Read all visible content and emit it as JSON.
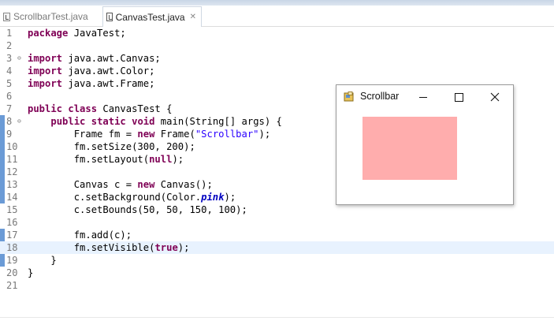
{
  "tabs": [
    {
      "label": "ScrollbarTest.java",
      "active": false
    },
    {
      "label": "CanvasTest.java",
      "active": true,
      "close": "✕"
    }
  ],
  "editor": {
    "lines": [
      {
        "num": "1",
        "tokens": [
          {
            "t": "package",
            "c": "kw"
          },
          {
            "t": " JavaTest;"
          }
        ]
      },
      {
        "num": "2",
        "tokens": []
      },
      {
        "num": "3",
        "fold": "⊖",
        "tokens": [
          {
            "t": "import",
            "c": "kw"
          },
          {
            "t": " java.awt.Canvas;"
          }
        ]
      },
      {
        "num": "4",
        "tokens": [
          {
            "t": "import",
            "c": "kw"
          },
          {
            "t": " java.awt.Color;"
          }
        ]
      },
      {
        "num": "5",
        "tokens": [
          {
            "t": "import",
            "c": "kw"
          },
          {
            "t": " java.awt.Frame;"
          }
        ]
      },
      {
        "num": "6",
        "tokens": []
      },
      {
        "num": "7",
        "tokens": [
          {
            "t": "public",
            "c": "kw"
          },
          {
            "t": " "
          },
          {
            "t": "class",
            "c": "kw"
          },
          {
            "t": " CanvasTest {"
          }
        ]
      },
      {
        "num": "8",
        "fold": "⊖",
        "tokens": [
          {
            "t": "    "
          },
          {
            "t": "public",
            "c": "kw"
          },
          {
            "t": " "
          },
          {
            "t": "static",
            "c": "kw"
          },
          {
            "t": " "
          },
          {
            "t": "void",
            "c": "kw"
          },
          {
            "t": " main(String[] args) {"
          }
        ]
      },
      {
        "num": "9",
        "tokens": [
          {
            "t": "        Frame fm = "
          },
          {
            "t": "new",
            "c": "kw"
          },
          {
            "t": " Frame("
          },
          {
            "t": "\"Scrollbar\"",
            "c": "str"
          },
          {
            "t": ");"
          }
        ]
      },
      {
        "num": "10",
        "tokens": [
          {
            "t": "        fm.setSize(300, 200);"
          }
        ]
      },
      {
        "num": "11",
        "tokens": [
          {
            "t": "        fm.setLayout("
          },
          {
            "t": "null",
            "c": "kw"
          },
          {
            "t": ");"
          }
        ]
      },
      {
        "num": "12",
        "tokens": []
      },
      {
        "num": "13",
        "tokens": [
          {
            "t": "        Canvas c = "
          },
          {
            "t": "new",
            "c": "kw"
          },
          {
            "t": " Canvas();"
          }
        ]
      },
      {
        "num": "14",
        "tokens": [
          {
            "t": "        c.setBackground(Color."
          },
          {
            "t": "pink",
            "c": "field"
          },
          {
            "t": ");"
          }
        ]
      },
      {
        "num": "15",
        "tokens": [
          {
            "t": "        c.setBounds(50, 50, 150, 100);"
          }
        ]
      },
      {
        "num": "16",
        "tokens": []
      },
      {
        "num": "17",
        "tokens": [
          {
            "t": "        fm.add(c);"
          }
        ]
      },
      {
        "num": "18",
        "current": true,
        "tokens": [
          {
            "t": "        fm.setVisible("
          },
          {
            "t": "true",
            "c": "kw"
          },
          {
            "t": ");"
          }
        ]
      },
      {
        "num": "19",
        "tokens": [
          {
            "t": "    }"
          }
        ]
      },
      {
        "num": "20",
        "tokens": [
          {
            "t": "}"
          }
        ]
      },
      {
        "num": "21",
        "tokens": []
      }
    ]
  },
  "window": {
    "title": "Scrollbar",
    "icon": "java-frame-icon",
    "canvas_color": "#ffadad",
    "title_bg": "#ffffff"
  },
  "colors": {
    "keyword": "#7f0055",
    "string": "#2a00ff",
    "field": "#0000c0",
    "current_line": "#e8f2fe",
    "change_marker": "#6b9bd6"
  }
}
